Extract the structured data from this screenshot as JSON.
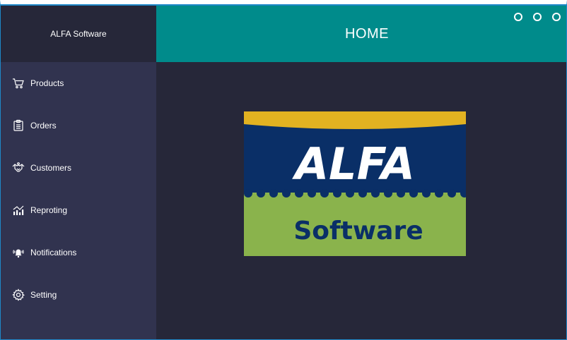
{
  "app": {
    "brand": "ALFA Software"
  },
  "header": {
    "title": "HOME"
  },
  "sidebar": {
    "items": [
      {
        "label": "Products",
        "icon": "cart-icon"
      },
      {
        "label": "Orders",
        "icon": "clipboard-list-icon"
      },
      {
        "label": "Customers",
        "icon": "handshake-icon"
      },
      {
        "label": "Reproting",
        "icon": "chart-icon"
      },
      {
        "label": "Notifications",
        "icon": "bell-icon"
      },
      {
        "label": "Setting",
        "icon": "gear-icon"
      }
    ]
  },
  "logo": {
    "line1": "ALFA",
    "line2": "Software"
  },
  "colors": {
    "sidebar": "#31334f",
    "background": "#262739",
    "header": "#008b8b",
    "logo_blue": "#0a2f67",
    "logo_green": "#8ab34c",
    "logo_gold": "#e2b221"
  }
}
